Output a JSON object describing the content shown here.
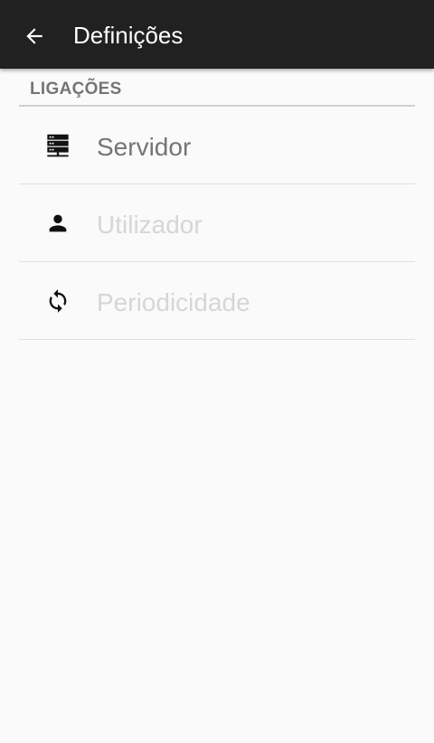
{
  "toolbar": {
    "back_icon": "arrow-back-icon",
    "title": "Definições",
    "background": "#212121"
  },
  "section": {
    "header": "LIGAÇÕES"
  },
  "preferences": [
    {
      "label": "Servidor",
      "icon": "server-icon",
      "enabled": true
    },
    {
      "label": "Utilizador",
      "icon": "person-icon",
      "enabled": false
    },
    {
      "label": "Periodicidade",
      "icon": "sync-icon",
      "enabled": false
    }
  ],
  "colors": {
    "background": "#fafafa",
    "enabled_text": "#757575",
    "disabled_text": "#d6d6d6",
    "divider": "#e0e0e0"
  }
}
